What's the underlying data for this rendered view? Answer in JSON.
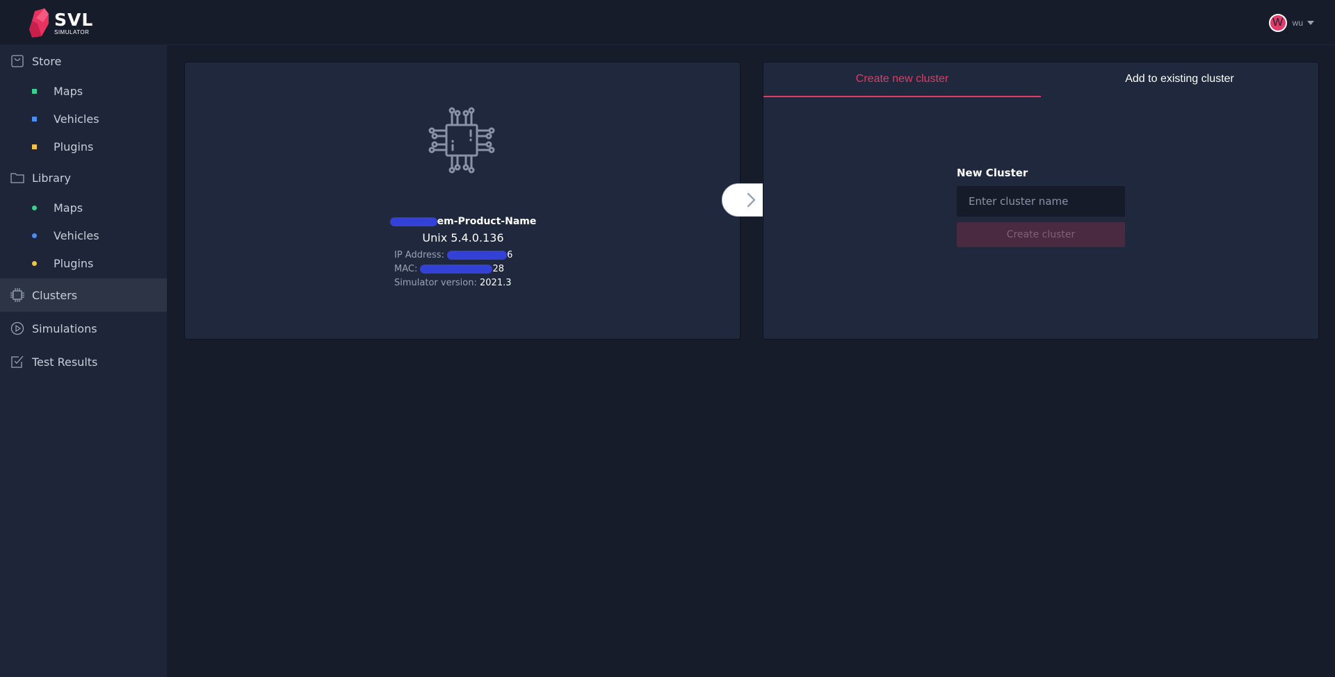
{
  "app": {
    "logo_text": "SVL",
    "logo_subtext": "SIMULATOR",
    "user": {
      "initial": "W",
      "name": "wu"
    }
  },
  "sidebar": {
    "store": {
      "label": "Store",
      "items": [
        {
          "label": "Maps",
          "color": "#3ccf91"
        },
        {
          "label": "Vehicles",
          "color": "#4a8ef0"
        },
        {
          "label": "Plugins",
          "color": "#f0c24a"
        }
      ]
    },
    "library": {
      "label": "Library",
      "items": [
        {
          "label": "Maps",
          "color": "#3ccf91"
        },
        {
          "label": "Vehicles",
          "color": "#4a8ef0"
        },
        {
          "label": "Plugins",
          "color": "#f0c24a"
        }
      ]
    },
    "clusters": {
      "label": "Clusters",
      "active": true
    },
    "simulations": {
      "label": "Simulations"
    },
    "test_results": {
      "label": "Test Results"
    }
  },
  "machine": {
    "name": "em-Product-Name",
    "os": "Unix 5.4.0.136",
    "ip_label": "IP Address:",
    "ip_value": "6",
    "mac_label": "MAC:",
    "mac_value": "28",
    "version_label": "Simulator version:",
    "version_value": "2021.3"
  },
  "cluster_panel": {
    "tabs": [
      "Create new cluster",
      "Add to existing cluster"
    ],
    "active_tab": "Create new cluster",
    "form_label": "New Cluster",
    "input_placeholder": "Enter cluster name",
    "input_value": "",
    "button_label": "Create cluster"
  }
}
